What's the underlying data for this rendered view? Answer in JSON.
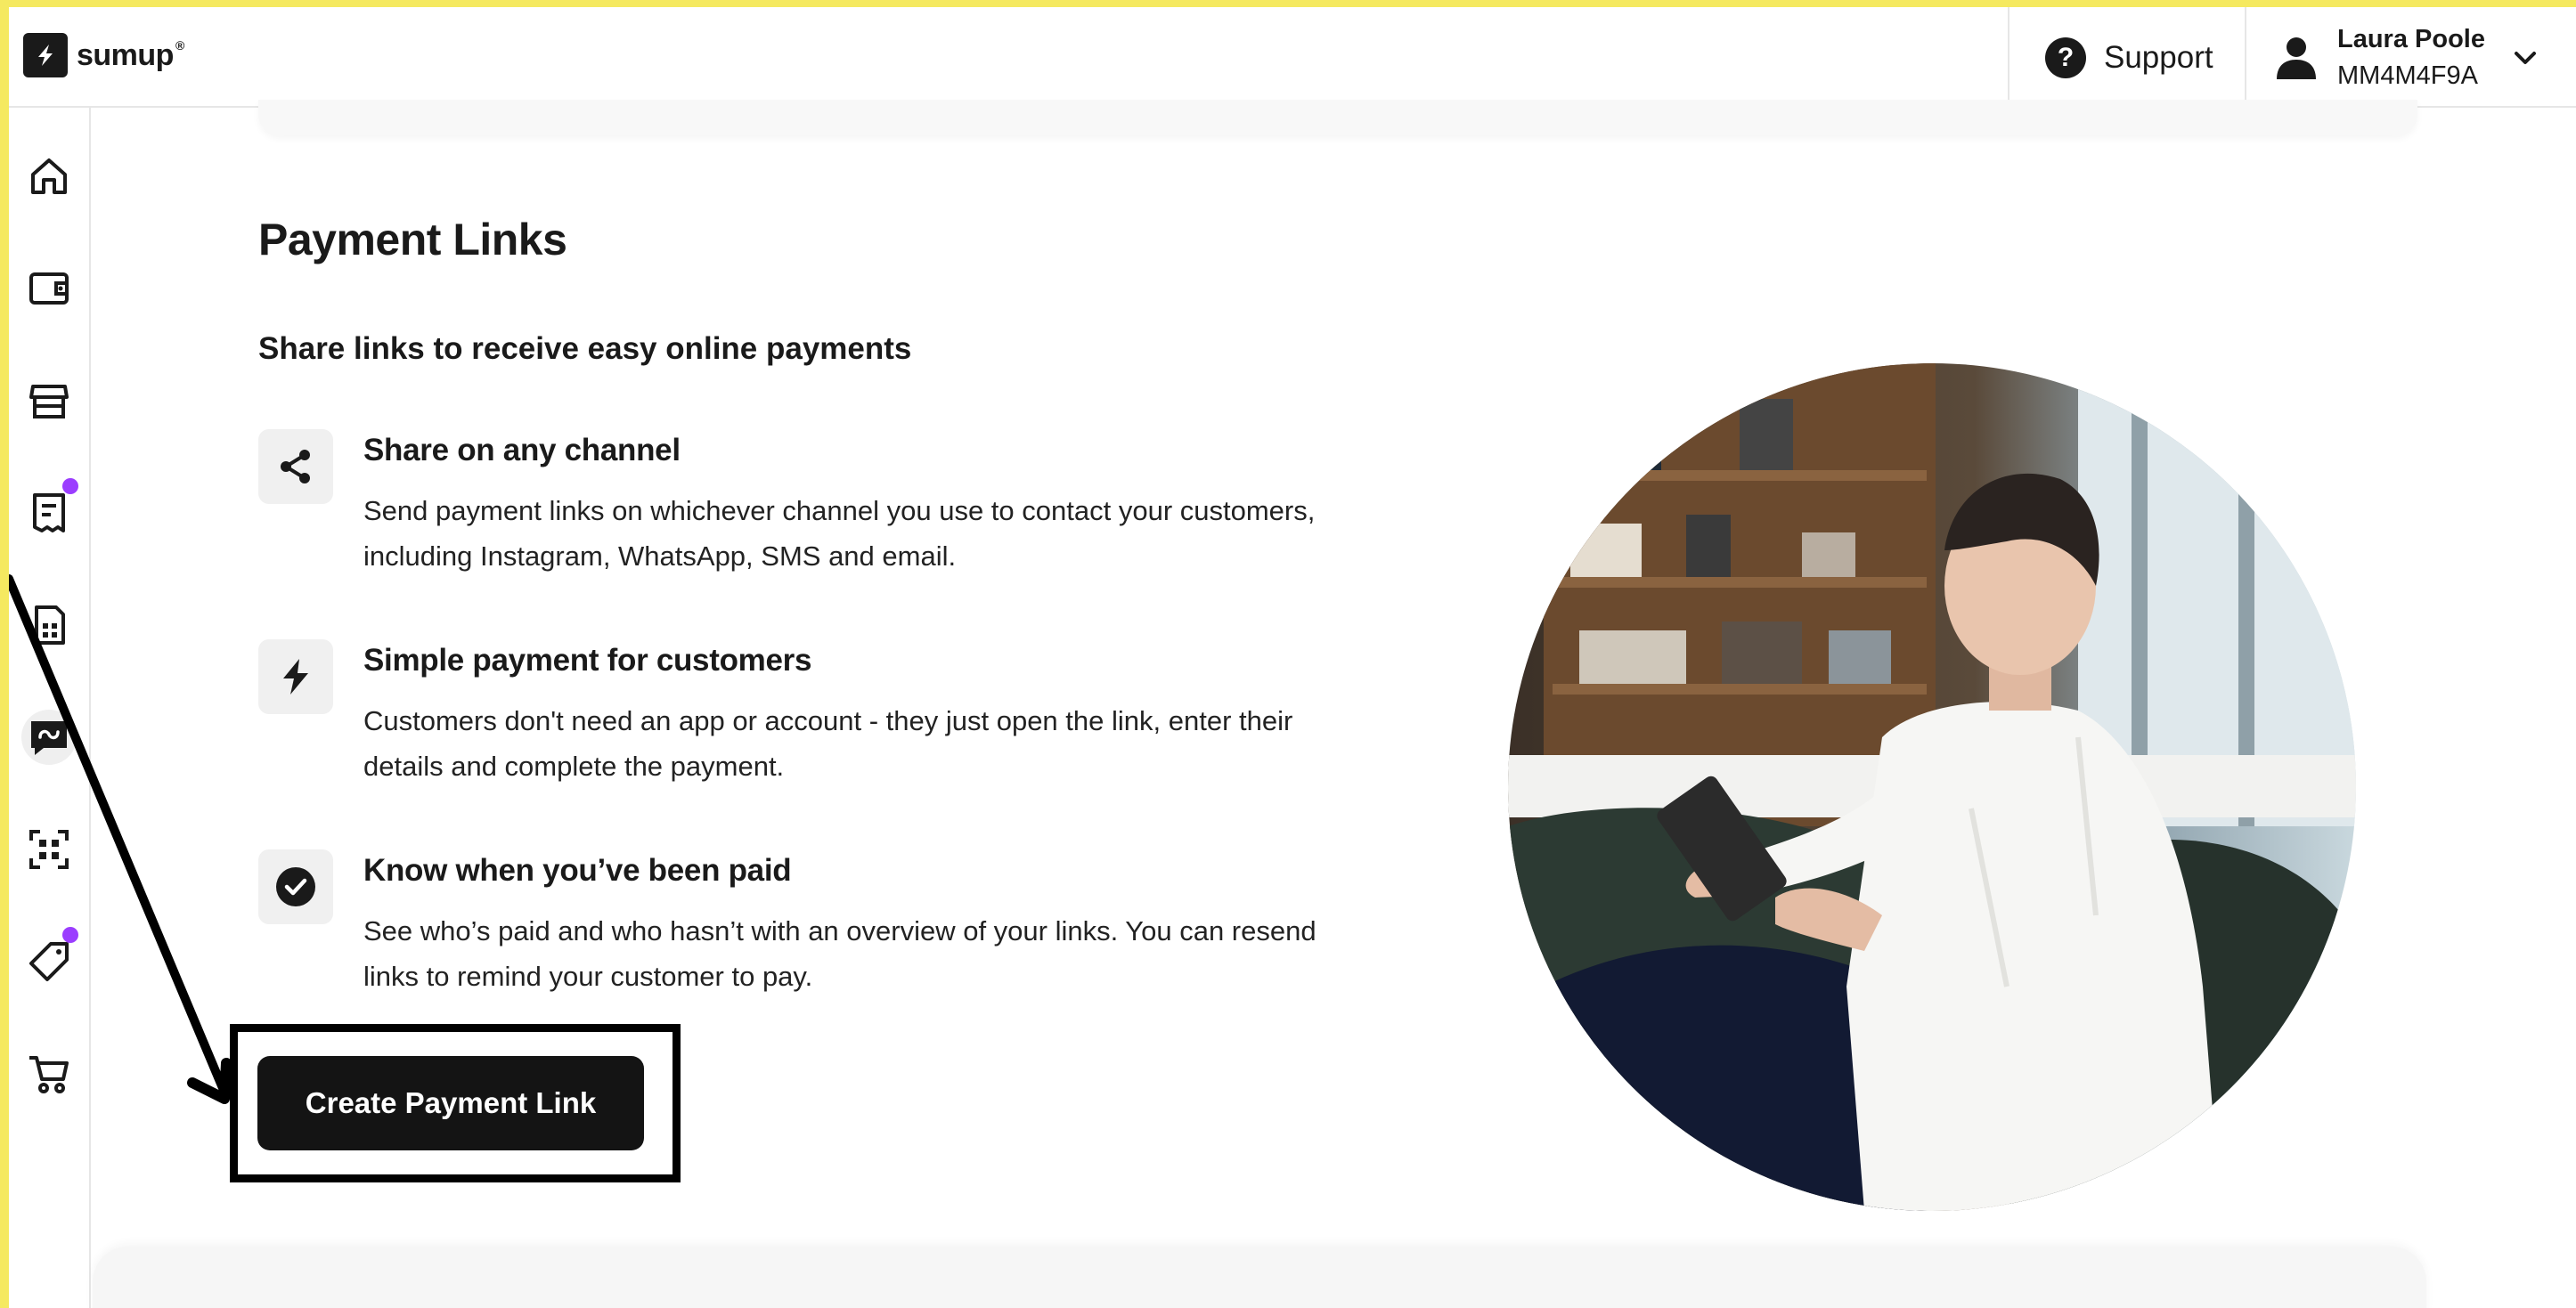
{
  "brand": {
    "logo_text": "sumup",
    "logo_reg": "®"
  },
  "header": {
    "support_label": "Support",
    "account_name": "Laura Poole",
    "account_id": "MM4M4F9A"
  },
  "sidebar": {
    "items": [
      {
        "icon": "home-icon",
        "active": false,
        "badge": false
      },
      {
        "icon": "wallet-icon",
        "active": false,
        "badge": false
      },
      {
        "icon": "storefront-icon",
        "active": false,
        "badge": false
      },
      {
        "icon": "receipt-icon",
        "active": false,
        "badge": true
      },
      {
        "icon": "invoice-icon",
        "active": false,
        "badge": false
      },
      {
        "icon": "payment-link-icon",
        "active": true,
        "badge": false
      },
      {
        "icon": "qr-code-icon",
        "active": false,
        "badge": false
      },
      {
        "icon": "tag-icon",
        "active": false,
        "badge": true
      },
      {
        "icon": "cart-icon",
        "active": false,
        "badge": false
      }
    ],
    "badge_color": "#9b3dff"
  },
  "main": {
    "title": "Payment Links",
    "subtitle": "Share links to receive easy online payments",
    "features": [
      {
        "icon": "share-icon",
        "title": "Share on any channel",
        "description": "Send payment links on whichever channel you use to contact your customers, including Instagram, WhatsApp, SMS and email."
      },
      {
        "icon": "lightning-icon",
        "title": "Simple payment for customers",
        "description": "Customers don't need an app or account - they just open the link, enter their details and complete the payment."
      },
      {
        "icon": "check-circle-icon",
        "title": "Know when you’ve been paid",
        "description": "See who’s paid and who hasn’t with an overview of your links. You can resend links to remind your customer to pay."
      }
    ],
    "cta_label": "Create Payment Link"
  },
  "colors": {
    "annotation_frame": "#f5e960",
    "button_bg": "#141414",
    "text": "#1a1a1a"
  }
}
